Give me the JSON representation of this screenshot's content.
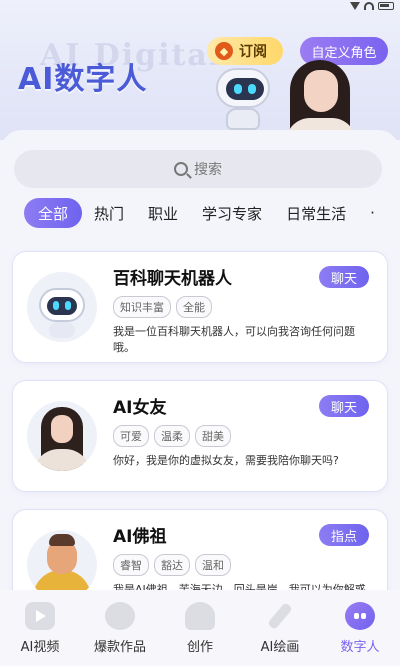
{
  "header": {
    "title": "AI数字人",
    "ghost_title": "AI Digital",
    "subscribe_label": "订阅",
    "subscribe_icon": "diamond-icon",
    "custom_role_label": "自定义角色"
  },
  "search": {
    "placeholder": "搜索"
  },
  "tabs": [
    {
      "label": "全部",
      "active": true
    },
    {
      "label": "热门"
    },
    {
      "label": "职业"
    },
    {
      "label": "学习专家"
    },
    {
      "label": "日常生活"
    },
    {
      "label": "·"
    }
  ],
  "cards": [
    {
      "title": "百科聊天机器人",
      "button": "聊天",
      "tags": [
        "知识丰富",
        "全能"
      ],
      "description": "我是一位百科聊天机器人，可以向我咨询任何问题哦。",
      "avatar": "robot-avatar"
    },
    {
      "title": "AI女友",
      "button": "聊天",
      "tags": [
        "可爱",
        "温柔",
        "甜美"
      ],
      "description": "你好，我是你的虚拟女友，需要我陪你聊天吗?",
      "avatar": "girlfriend-avatar"
    },
    {
      "title": "AI佛祖",
      "button": "指点",
      "tags": [
        "睿智",
        "豁达",
        "温和"
      ],
      "description": "我是AI佛祖，苦海无边，回头是岸，我可以为你解惑",
      "avatar": "buddha-avatar"
    }
  ],
  "bottom_nav": [
    {
      "label": "AI视频",
      "icon": "video-icon"
    },
    {
      "label": "爆款作品",
      "icon": "flame-icon"
    },
    {
      "label": "创作",
      "icon": "lightbulb-icon"
    },
    {
      "label": "AI绘画",
      "icon": "brush-icon"
    },
    {
      "label": "数字人",
      "icon": "digital-human-icon",
      "active": true
    }
  ],
  "colors": {
    "accent": "#7a63ef",
    "title_blue": "#4b5bd8",
    "subscribe_gold": "#ffd86a"
  }
}
